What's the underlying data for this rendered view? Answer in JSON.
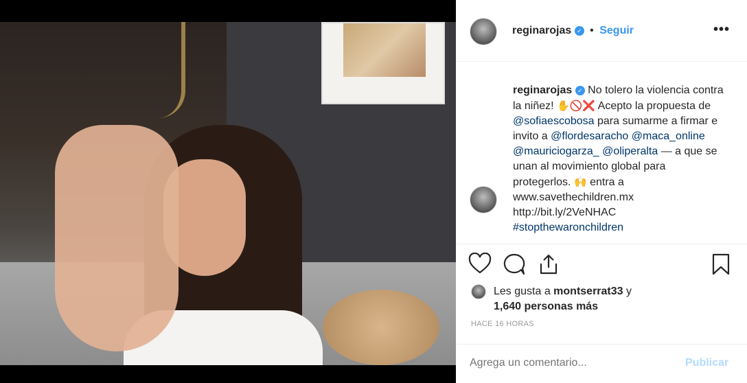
{
  "post": {
    "username": "reginarojas",
    "verified_icon": "verified-badge-icon",
    "separator": "•",
    "follow_label": "Seguir",
    "more_icon": "more-options-icon",
    "more_glyph": "•••"
  },
  "caption": {
    "username": "reginarojas",
    "t1": " No tolero la violencia contra la niñez! ",
    "emoji1": "✋🚫❌",
    "t2": " Acepto la propuesta de ",
    "m1": "@sofiaescobosa",
    "t3": " para sumarme a firmar e invito a ",
    "m2": "@flordesaracho",
    "m3": "@maca_online",
    "m4": "@mauriciogarza_",
    "m5": "@oliperalta",
    "t4": " — a que se unan al movimiento global para protegerlos. ",
    "emoji2": "🙌",
    "t5": " entra a www.savethechildren.mx http://bit.ly/2VeNHAC",
    "hashtag": "#stopthewaronchildren"
  },
  "actions": {
    "like_icon": "heart-icon",
    "comment_icon": "comment-icon",
    "share_icon": "share-icon",
    "save_icon": "bookmark-icon"
  },
  "likes": {
    "prefix": "Les gusta a ",
    "user": "montserrat33",
    "middle": " y ",
    "count": "1,640 personas más"
  },
  "timestamp": "HACE 16 HORAS",
  "comment_box": {
    "placeholder": "Agrega un comentario...",
    "publish_label": "Publicar"
  },
  "colors": {
    "accent": "#3897f0",
    "mention": "#003569",
    "publish_disabled": "#b3dbff"
  }
}
